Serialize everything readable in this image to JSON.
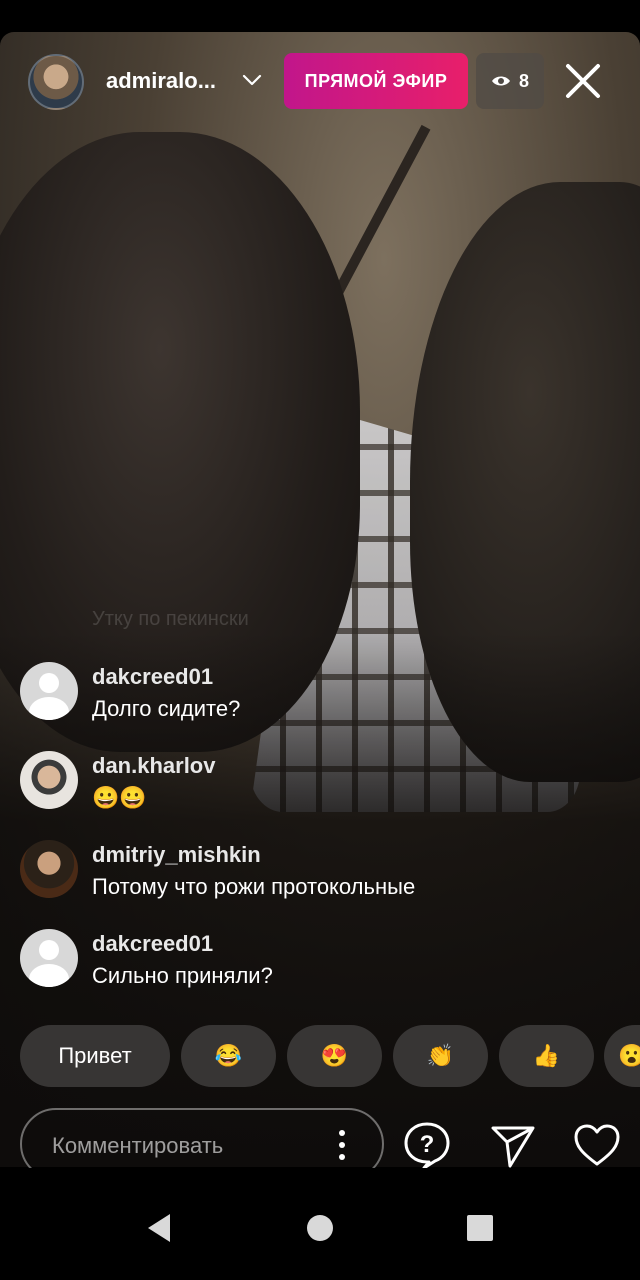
{
  "header": {
    "host_username": "admiralo...",
    "live_label": "ПРЯМОЙ ЭФИР",
    "viewer_count": "8"
  },
  "faded_comment": "Утку по пекински",
  "comments": [
    {
      "user": "dakcreed01",
      "text": "Долго сидите?"
    },
    {
      "user": "dan.kharlov",
      "text": "😀😀"
    },
    {
      "user": "dmitriy_mishkin",
      "text": "Потому что рожи протокольные"
    },
    {
      "user": "dakcreed01",
      "text": "Сильно приняли?"
    }
  ],
  "quick_replies": [
    "Привет",
    "😂",
    "😍",
    "👏",
    "👍",
    "😮"
  ],
  "comment_input": {
    "placeholder": "Комментировать"
  },
  "colors": {
    "live_gradient_start": "#c1168b",
    "live_gradient_end": "#e81f6a"
  }
}
